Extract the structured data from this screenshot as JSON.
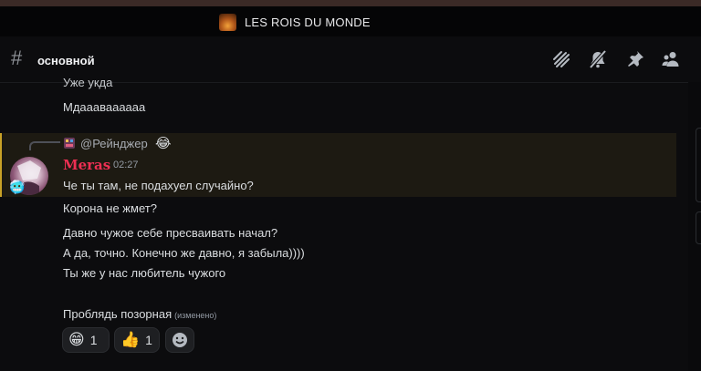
{
  "server": {
    "name": "LES ROIS DU MONDE"
  },
  "channel": {
    "name": "основной",
    "hash": "#"
  },
  "toolbar": {
    "icons": [
      "threads-icon",
      "mute-bell-icon",
      "pin-icon",
      "members-icon"
    ]
  },
  "prev_lines": [
    "Уже укда",
    "Мдаааваааааа"
  ],
  "reply": {
    "author": "@Рейнджер",
    "emoji": "😂"
  },
  "message": {
    "author": "Meras",
    "author_color": "#ed2f53",
    "time": "02:27",
    "lines": [
      "Че ты там, не подахуел случайно?",
      "Корона не жмет?",
      "Давно чужое себе пресваивать начал?",
      "А да, точно. Конечно же давно, я забыла))))",
      "Ты же у нас любитель чужого",
      "Проблядь позорная"
    ],
    "edited_label": "(изменено)"
  },
  "reactions": [
    {
      "emoji": "😁",
      "count": "1"
    },
    {
      "emoji": "👍",
      "count": "1"
    }
  ]
}
